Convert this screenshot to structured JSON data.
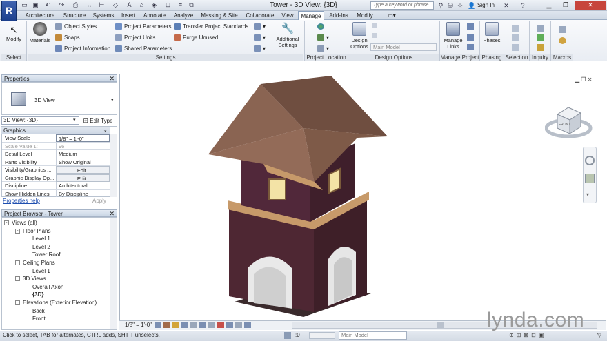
{
  "app": {
    "logo": "R",
    "title": "Tower - 3D View: {3D}",
    "search_placeholder": "Type a keyword or phrase",
    "sign_in": "Sign In"
  },
  "tabs": [
    "Architecture",
    "Structure",
    "Systems",
    "Insert",
    "Annotate",
    "Analyze",
    "Massing & Site",
    "Collaborate",
    "View",
    "Manage",
    "Add-Ins",
    "Modify"
  ],
  "active_tab": "Manage",
  "ribbon": {
    "modify": "Modify",
    "materials": "Materials",
    "settings_items": [
      "Object Styles",
      "Snaps",
      "Project Information",
      "Project Parameters",
      "Project Units",
      "Shared Parameters",
      "Transfer Project Standards",
      "Purge Unused"
    ],
    "additional_settings": "Additional Settings",
    "design_options_btn": "Design Options",
    "main_model": "Main Model",
    "manage_links": "Manage Links",
    "phases": "Phases",
    "panels": [
      "Select",
      "Settings",
      "Project Location",
      "Design Options",
      "Manage Project",
      "Phasing",
      "Selection",
      "Inquiry",
      "Macros"
    ]
  },
  "properties": {
    "header": "Properties",
    "type_name": "3D View",
    "selector": "3D View: {3D}",
    "edit_type": "Edit Type",
    "group": "Graphics",
    "rows": [
      {
        "name": "View Scale",
        "value": "1/8\" = 1'-0\""
      },
      {
        "name": "Scale Value    1:",
        "value": "96"
      },
      {
        "name": "Detail Level",
        "value": "Medium"
      },
      {
        "name": "Parts Visibility",
        "value": "Show Original"
      },
      {
        "name": "Visibility/Graphics ...",
        "value": "Edit..."
      },
      {
        "name": "Graphic Display Op...",
        "value": "Edit..."
      },
      {
        "name": "Discipline",
        "value": "Architectural"
      },
      {
        "name": "Show Hidden Lines",
        "value": "By Discipline"
      }
    ],
    "help": "Properties help",
    "apply": "Apply"
  },
  "browser": {
    "header": "Project Browser - Tower",
    "items": [
      {
        "label": "Views (all)",
        "level": 0,
        "box": "-"
      },
      {
        "label": "Floor Plans",
        "level": 1,
        "box": "-"
      },
      {
        "label": "Level 1",
        "level": 2
      },
      {
        "label": "Level 2",
        "level": 2
      },
      {
        "label": "Tower Roof",
        "level": 2
      },
      {
        "label": "Ceiling Plans",
        "level": 1,
        "box": "-"
      },
      {
        "label": "Level 1",
        "level": 2
      },
      {
        "label": "3D Views",
        "level": 1,
        "box": "-"
      },
      {
        "label": "Overall Axon",
        "level": 2
      },
      {
        "label": "{3D}",
        "level": 2,
        "bold": true
      },
      {
        "label": "Elevations (Exterior Elevation)",
        "level": 1,
        "box": "-"
      },
      {
        "label": "Back",
        "level": 2
      },
      {
        "label": "Front",
        "level": 2
      }
    ]
  },
  "view": {
    "scale": "1/8\" = 1'-0\"",
    "viewcube_face": "FRONT"
  },
  "status": {
    "text": "Click to select, TAB for alternates, CTRL adds, SHIFT unselects.",
    "zero": ":0",
    "model": "Main Model"
  },
  "watermark": "lynda.com",
  "colors": {
    "roof": "#7a5a4a",
    "brick": "#4e2733",
    "trim": "#c79a6a",
    "ribbon_bg": "#eef1f5"
  }
}
